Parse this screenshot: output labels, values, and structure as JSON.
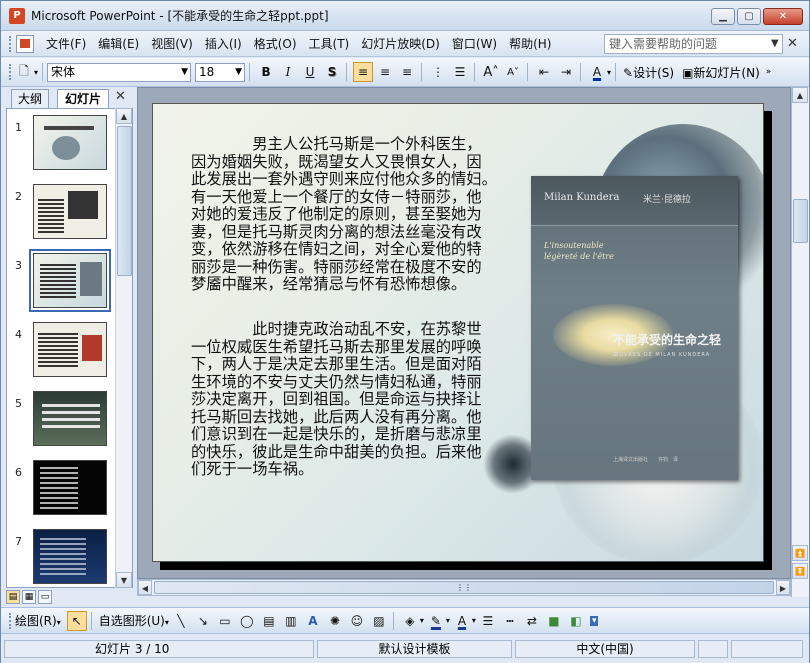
{
  "window": {
    "title": "Microsoft PowerPoint - [不能承受的生命之轻ppt.ppt]",
    "app_icon": "powerpoint-icon"
  },
  "menubar": {
    "items": [
      "文件(F)",
      "编辑(E)",
      "视图(V)",
      "插入(I)",
      "格式(O)",
      "工具(T)",
      "幻灯片放映(D)",
      "窗口(W)",
      "帮助(H)"
    ],
    "help_placeholder": "键入需要帮助的问题"
  },
  "toolbar": {
    "font_name": "宋体",
    "font_size": "18",
    "bold": "B",
    "italic": "I",
    "underline": "U",
    "shadow": "S",
    "design_label": "设计(S)",
    "new_slide_label": "新幻灯片(N)"
  },
  "panel": {
    "tabs": [
      "大纲",
      "幻灯片"
    ],
    "selected_tab": "幻灯片",
    "slide_numbers": [
      "1",
      "2",
      "3",
      "4",
      "5",
      "6",
      "7"
    ],
    "selected_slide": "3"
  },
  "slide": {
    "paragraph1": [
      "　　　　男主人公托马斯是一个外科医生，",
      "因为婚姻失败，既渴望女人又畏惧女人，因",
      "此发展出一套外遇守则来应付他众多的情妇。",
      "有一天他爱上一个餐厅的女侍－特丽莎，他",
      "对她的爱违反了他制定的原则，甚至娶她为",
      "妻，但是托马斯灵肉分离的想法丝毫没有改",
      "变，依然游移在情妇之间，对全心爱他的特",
      "丽莎是一种伤害。特丽莎经常在极度不安的",
      "梦靥中醒来，经常猜忌与怀有恐怖想像。"
    ],
    "paragraph2": [
      "　　　　此时捷克政治动乱不安，在苏黎世",
      "一位权威医生希望托马斯去那里发展的呼唤",
      "下，两人于是决定去那里生活。但是面对陌",
      "生环境的不安与丈夫仍然与情妇私通，特丽",
      "莎决定离开，回到祖国。但是命运与抉择让",
      "托马斯回去找她，此后两人没有再分离。他",
      "们意识到在一起是快乐的，是折磨与悲凉里",
      "的快乐，彼此是生命中甜美的负担。后来他",
      "们死于一场车祸。"
    ],
    "book": {
      "author_latin": "Milan Kundera",
      "author_cn": "米兰·昆德拉",
      "title_fr_line1": "L'insoutenable",
      "title_fr_line2": "légèreté de l'être",
      "title_cn": "不能承受的生命之轻",
      "subtitle": "ŒUVRES DE MILAN KUNDERA",
      "publisher": "上海译文出版社　　许钧　译"
    }
  },
  "drawbar": {
    "draw_label": "绘图(R)",
    "autoshape_label": "自选图形(U)"
  },
  "status": {
    "slide_position": "幻灯片 3 / 10",
    "template": "默认设计模板",
    "language": "中文(中国)"
  },
  "colors": {
    "accent": "#d24726",
    "selection": "#3a69b5",
    "toolbar_active": "#fadf9c"
  }
}
